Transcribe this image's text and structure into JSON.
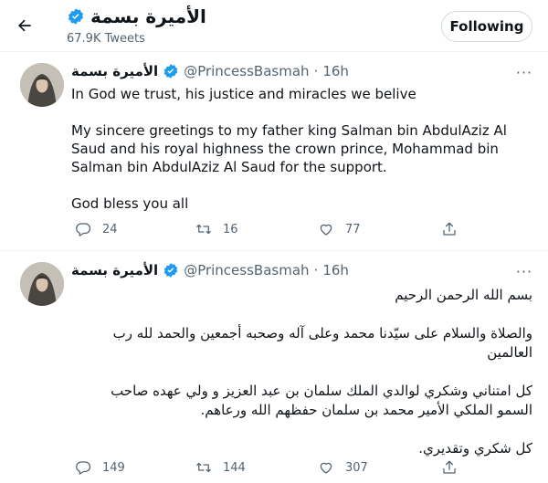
{
  "header": {
    "name": "الأميرة بسمة",
    "tweet_count": "67.9K Tweets",
    "follow_label": "Following"
  },
  "tweets": [
    {
      "name": "الأميرة بسمة",
      "handle": "@PrincessBasmah",
      "separator": "·",
      "time": "16h",
      "paragraphs": [
        "In God we trust, his justice and miracles we belive",
        "My sincere greetings to my father king Salman bin AbdulAziz Al Saud and his royal highness the crown prince, Mohammad bin Salman bin AbdulAziz Al Saud for the support.",
        "God bless you all"
      ],
      "replies": "24",
      "retweets": "16",
      "likes": "77"
    },
    {
      "name": "الأميرة بسمة",
      "handle": "@PrincessBasmah",
      "separator": "·",
      "time": "16h",
      "paragraphs": [
        "بسم الله الرحمن الرحيم",
        "والصلاة والسلام على سيّدنا محمد وعلى آله وصحبه أجمعين والحمد لله رب العالمين",
        "كل امتناني وشكري لوالدي الملك سلمان بن عبد العزيز و ولي عهده صاحب السمو الملكي الأمير محمد بن سلمان حفظهم الله ورعاهم.",
        "كل شكري وتقديري."
      ],
      "replies": "149",
      "retweets": "144",
      "likes": "307"
    }
  ],
  "colors": {
    "verified": "#1d9bf0",
    "text": "#0f1419",
    "secondary": "#536471",
    "divider": "#eff3f4"
  },
  "icons": [
    "back-arrow-icon",
    "verified-badge-icon",
    "more-icon",
    "reply-icon",
    "retweet-icon",
    "like-icon",
    "share-icon"
  ]
}
